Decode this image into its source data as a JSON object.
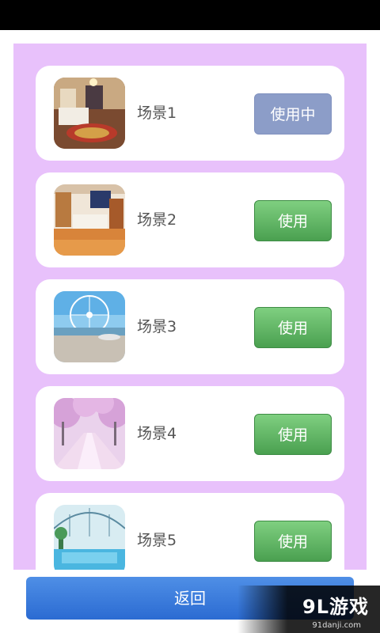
{
  "scenes": [
    {
      "label": "场景1",
      "button": "使用中",
      "state": "active"
    },
    {
      "label": "场景2",
      "button": "使用",
      "state": "available"
    },
    {
      "label": "场景3",
      "button": "使用",
      "state": "available"
    },
    {
      "label": "场景4",
      "button": "使用",
      "state": "available"
    },
    {
      "label": "场景5",
      "button": "使用",
      "state": "available"
    }
  ],
  "back_label": "返回",
  "watermark": {
    "brand": "9L游戏",
    "site": "91danji.com"
  },
  "colors": {
    "panel": "#e8c1fb",
    "use_button": "#5fb562",
    "in_use_button": "#8c9dc8",
    "back_button": "#3a7ddc"
  }
}
